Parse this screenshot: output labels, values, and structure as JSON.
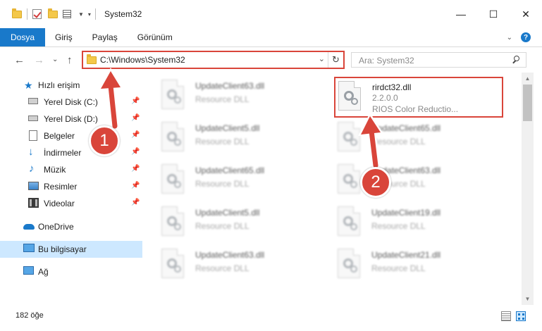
{
  "window": {
    "title": "System32",
    "controls": {
      "minimize": "—",
      "maximize": "☐",
      "close": "✕"
    }
  },
  "ribbon": {
    "tabs": [
      "Dosya",
      "Giriş",
      "Paylaş",
      "Görünüm"
    ],
    "help": "?"
  },
  "address": {
    "path": "C:\\Windows\\System32",
    "search_placeholder": "Ara: System32"
  },
  "nav": {
    "quick_access": "Hızlı erişim",
    "items": [
      {
        "label": "Yerel Disk (C:)",
        "icon": "drive-icon",
        "pinned": true
      },
      {
        "label": "Yerel Disk (D:)",
        "icon": "drive-icon",
        "pinned": true
      },
      {
        "label": "Belgeler",
        "icon": "documents-icon",
        "pinned": true
      },
      {
        "label": "İndirmeler",
        "icon": "download-icon",
        "pinned": true
      },
      {
        "label": "Müzik",
        "icon": "music-icon",
        "pinned": true
      },
      {
        "label": "Resimler",
        "icon": "pictures-icon",
        "pinned": true
      },
      {
        "label": "Videolar",
        "icon": "videos-icon",
        "pinned": true
      }
    ],
    "onedrive": "OneDrive",
    "this_pc": "Bu bilgisayar",
    "network": "Ağ"
  },
  "files": {
    "highlighted": {
      "name": "rirdct32.dll",
      "version": "2.2.0.0",
      "description": "RIOS Color Reductio..."
    },
    "left_column": [
      {
        "name": "UpdateClient63.dll",
        "type": "Resource DLL"
      },
      {
        "name": "UpdateClient5.dll",
        "type": "Resource DLL"
      },
      {
        "name": "UpdateClient65.dll",
        "type": "Resource DLL"
      },
      {
        "name": "UpdateClient5.dll",
        "type": "Resource DLL"
      },
      {
        "name": "UpdateClient63.dll",
        "type": "Resource DLL"
      }
    ],
    "right_column": [
      {
        "name": "UpdateClient65.dll",
        "type": "Resource DLL"
      },
      {
        "name": "UpdateClient63.dll",
        "type": "Resource DLL"
      },
      {
        "name": "UpdateClient19.dll",
        "type": "Resource DLL"
      },
      {
        "name": "UpdateClient21.dll",
        "type": "Resource DLL"
      }
    ]
  },
  "status": {
    "item_count": "182 öğe"
  },
  "annotations": {
    "step1": "1",
    "step2": "2"
  },
  "colors": {
    "accent": "#1979ca",
    "highlight": "#d9453a",
    "selection": "#cde8ff"
  }
}
